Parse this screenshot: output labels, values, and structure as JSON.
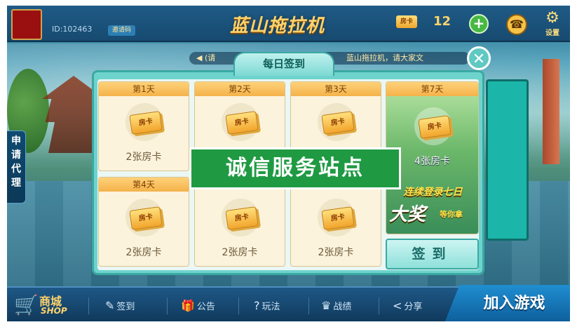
{
  "header": {
    "user_id": "ID:102463",
    "invite_label": "邀请码",
    "game_title": "蓝山拖拉机",
    "room_card_badge": "房卡",
    "room_card_count": "12",
    "settings_label": "设置"
  },
  "side": {
    "apply_agent_chars": [
      "申",
      "请",
      "代",
      "理"
    ]
  },
  "marquee": {
    "left": "(请",
    "right": "蓝山拖拉机，请大家文"
  },
  "modal": {
    "title": "每日签到",
    "close_glyph": "✕",
    "days": [
      {
        "label": "第1天",
        "reward": "2张房卡",
        "ticket": "房卡"
      },
      {
        "label": "第2天",
        "reward": "",
        "ticket": "房卡"
      },
      {
        "label": "第3天",
        "reward": "",
        "ticket": "房卡"
      },
      {
        "label": "第4天",
        "reward": "2张房卡",
        "ticket": "房卡"
      },
      {
        "label": "",
        "reward": "2张房卡",
        "ticket": "房卡"
      },
      {
        "label": "",
        "reward": "2张房卡",
        "ticket": "房卡"
      }
    ],
    "day7": {
      "label": "第7天",
      "reward": "4张房卡",
      "ticket": "房卡",
      "promo_line1": "连续登录七日",
      "promo_big": "大奖",
      "promo_small": "等你拿"
    },
    "sign_button": "签到"
  },
  "watermark": "诚信服务站点",
  "bottom_nav": {
    "shop_cn": "商城",
    "shop_en": "SHOP",
    "items": [
      {
        "icon": "✎",
        "label": "签到"
      },
      {
        "icon": "🎁",
        "label": "公告"
      },
      {
        "icon": "?",
        "label": "玩法"
      },
      {
        "icon": "♛",
        "label": "战绩"
      },
      {
        "icon": "<",
        "label": "分享"
      }
    ],
    "join_game": "加入游戏"
  },
  "colors": {
    "accent_teal": "#6fd3cd",
    "gold": "#ffd36b",
    "watermark_green": "#1f9a43"
  }
}
